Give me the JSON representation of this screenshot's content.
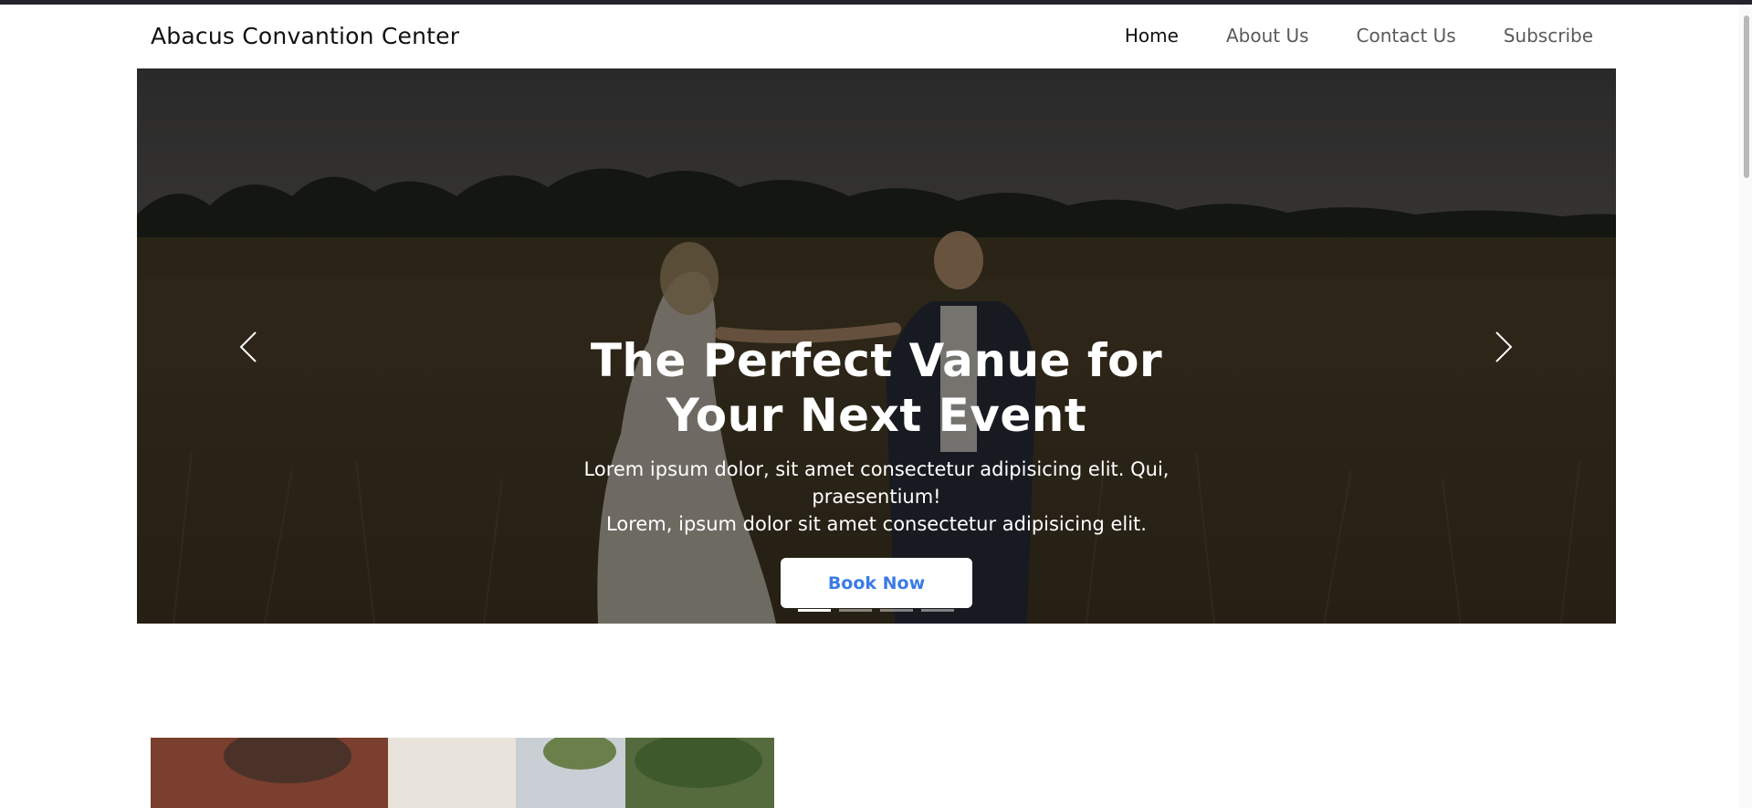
{
  "brand": {
    "name": "Abacus Convantion Center"
  },
  "nav": {
    "items": [
      {
        "label": "Home",
        "active": true
      },
      {
        "label": "About Us",
        "active": false
      },
      {
        "label": "Contact Us",
        "active": false
      },
      {
        "label": "Subscribe",
        "active": false
      }
    ]
  },
  "hero": {
    "title": "The Perfect Vanue for Your Next Event",
    "subtitle_line1": "Lorem ipsum dolor, sit amet consectetur adipisicing elit. Qui, praesentium!",
    "subtitle_line2": "Lorem, ipsum dolor sit amet consectetur adipisicing elit.",
    "button_label": "Book Now",
    "prev_icon": "chevron-left-icon",
    "next_icon": "chevron-right-icon",
    "slide_count": 4,
    "active_slide": 1
  },
  "colors": {
    "accent": "#3b7be6",
    "text_dark": "#111111",
    "nav_text": "#5a5a5a",
    "top_bar": "#23242b"
  }
}
